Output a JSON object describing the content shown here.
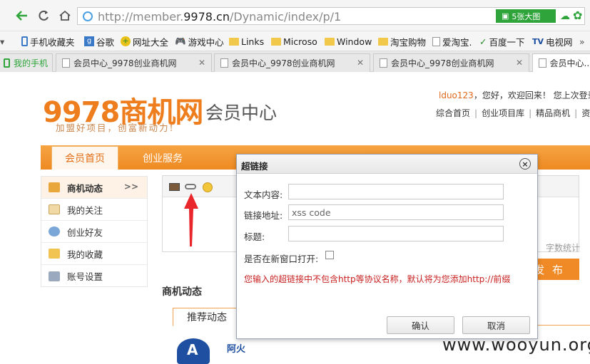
{
  "browser": {
    "url": "http://member.9978.cn/Dynamic/index/p/1",
    "url_prefix": "http://member.",
    "url_domain": "9978.cn",
    "url_path": "/Dynamic/index/p/1",
    "img_button": "5张大图"
  },
  "bookmarks": [
    {
      "label": "手机收藏夹",
      "icon": "phone-icon"
    },
    {
      "label": "谷歌",
      "icon": "google-icon"
    },
    {
      "label": "网址大全",
      "icon": "star-icon"
    },
    {
      "label": "游戏中心",
      "icon": "gamepad-icon"
    },
    {
      "label": "Links",
      "icon": "folder-icon"
    },
    {
      "label": "Microso",
      "icon": "folder-icon"
    },
    {
      "label": "Window",
      "icon": "folder-icon"
    },
    {
      "label": "淘宝购物",
      "icon": "folder-icon"
    },
    {
      "label": "爱淘宝.",
      "icon": "page-icon"
    },
    {
      "label": "百度一下",
      "icon": "baidu-icon"
    },
    {
      "label": "电视网",
      "icon": "tv-icon"
    }
  ],
  "tabs": [
    {
      "label": "我的手机"
    },
    {
      "label": "会员中心_9978创业商机网"
    },
    {
      "label": "会员中心_9978创业商机网"
    },
    {
      "label": "会员中心_9978创业商机网"
    },
    {
      "label": "会员中心..."
    }
  ],
  "header": {
    "logo_text": "9978商机网",
    "tagline": "加盟好项目，创富新动力!",
    "member_title": "会员中心",
    "welcome_user": "lduo123",
    "welcome_text": "，您好，欢迎回来！  您上次登录",
    "links": [
      "综合首页",
      "创业项目库",
      "精品商机",
      "资"
    ]
  },
  "nav": {
    "home": "会员首页",
    "biz": "创业服务"
  },
  "sidebar": {
    "items": [
      {
        "label": "商机动态",
        "arrow": ">>"
      },
      {
        "label": "我的关注"
      },
      {
        "label": "创业好友"
      },
      {
        "label": "我的收藏"
      },
      {
        "label": "账号设置"
      }
    ]
  },
  "editor": {
    "word_count": "字数统计",
    "publish": "发 布"
  },
  "section": {
    "title": "商机动态",
    "tab": "推荐动态",
    "company": "阿火"
  },
  "dialog": {
    "title": "超链接",
    "close": "×",
    "text_label": "文本内容:",
    "text_value": "",
    "link_label": "链接地址:",
    "link_value": "xss code",
    "title_label": "标题:",
    "title_value": "",
    "newwin_label": "是否在新窗口打开:",
    "note": "您输入的超链接中不包含http等协议名称，默认将为您添加http://前缀",
    "ok": "确认",
    "cancel": "取消"
  },
  "watermark": "www.wooyun.org",
  "colors": {
    "brand_orange": "#ee7d1e",
    "note_red": "#c81e1e",
    "arrow_red": "#e8262b"
  }
}
